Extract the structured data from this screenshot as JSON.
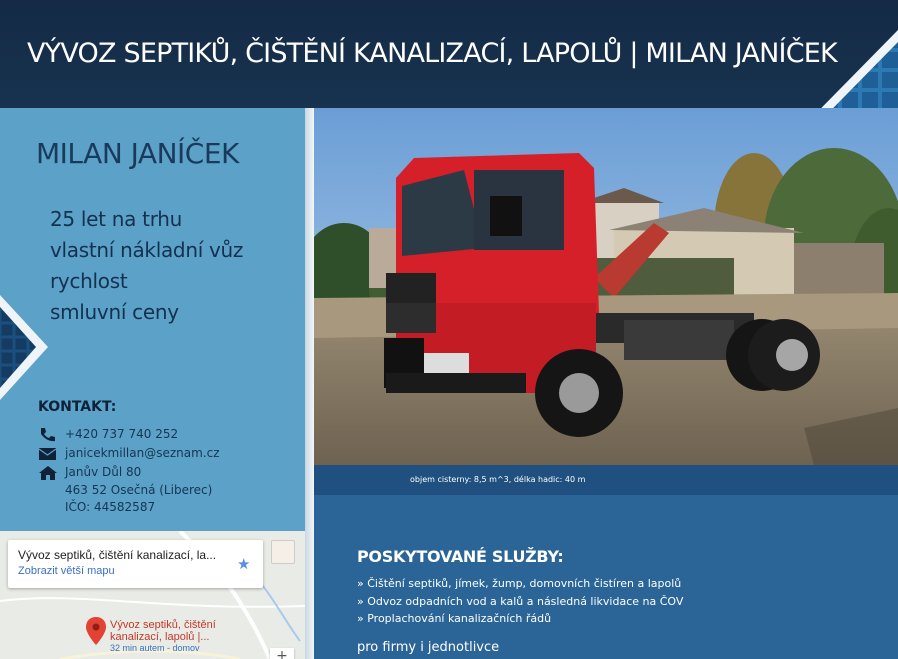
{
  "header": {
    "title": "VÝVOZ SEPTIKŮ, ČIŠTĚNÍ KANALIZACÍ, LAPOLŮ | MILAN JANÍČEK"
  },
  "sidebar": {
    "name": "MILAN JANÍČEK",
    "features": [
      "25 let na trhu",
      "vlastní nákladní vůz",
      "rychlost",
      "smluvní ceny"
    ],
    "contact": {
      "title": "KONTAKT:",
      "phone": "+420 737 740 252",
      "email": "janicekmillan@seznam.cz",
      "address_line1": "Janův Důl 80",
      "address_line2": "463 52 Osečná (Liberec)",
      "ico": "IČO: 44582587"
    }
  },
  "photo": {
    "caption": "objem cisterny: 8,5 m^3, délka hadic: 40 m"
  },
  "services": {
    "title": "POSKYTOVANÉ SLUŽBY:",
    "items": [
      "» Čištění septiků, jímek, žump, domovních čistíren a lapolů",
      "» Odvoz odpadních vod a kalů a následná likvidace na ČOV",
      "» Proplachování kanalizačních řádů"
    ],
    "note": "pro firmy i jednotlivce"
  },
  "map": {
    "card_title": "Vývoz septiků, čištění kanalizací, la...",
    "card_link": "Zobrazit větší mapu",
    "pin_label_line1": "Vývoz septiků, čištění",
    "pin_label_line2": "kanalizací, lapolů |...",
    "eta": "32 min autem - domov",
    "zoom_in": "+"
  },
  "colors": {
    "header_bg": "#142a45",
    "sidebar_bg": "#5ba1c8",
    "services_bg": "#2b6597",
    "truck_red": "#d5202a"
  },
  "icons": [
    "phone-icon",
    "email-icon",
    "home-icon",
    "star-icon",
    "map-pin-icon"
  ]
}
